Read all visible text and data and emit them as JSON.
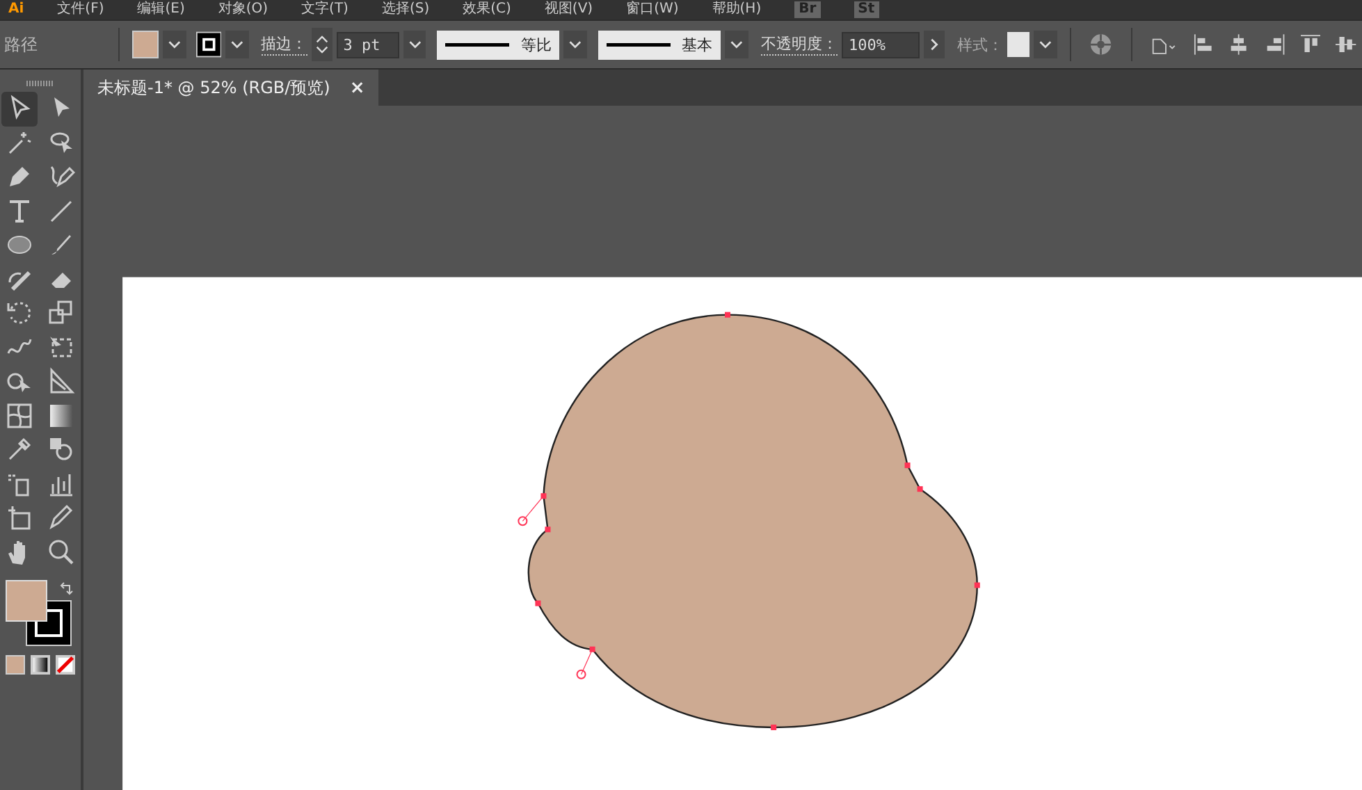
{
  "menu_bar": {
    "logo": "Ai",
    "items": [
      "文件(F)",
      "编辑(E)",
      "对象(O)",
      "文字(T)",
      "选择(S)",
      "效果(C)",
      "视图(V)",
      "窗口(W)",
      "帮助(H)"
    ],
    "apps": [
      "Br",
      "St"
    ]
  },
  "control_bar": {
    "object_type": "路径",
    "fill": {
      "color": "#cdaa92"
    },
    "stroke_label": "描边：",
    "stroke_weight": "3 pt",
    "profile": "等比",
    "brush": "基本",
    "opacity_label": "不透明度：",
    "opacity": "100%",
    "style_label": "样式："
  },
  "document_tab": {
    "title": "未标题-1* @ 52% (RGB/预览)",
    "close": "×"
  },
  "tools": [
    {
      "kind": "select",
      "selected": true
    },
    {
      "kind": "direct",
      "selected": false
    },
    {
      "kind": "wand",
      "selected": false
    },
    {
      "kind": "lasso",
      "selected": false
    },
    {
      "kind": "pen",
      "selected": false
    },
    {
      "kind": "curvature",
      "selected": false
    },
    {
      "kind": "type",
      "selected": false
    },
    {
      "kind": "line",
      "selected": false
    },
    {
      "kind": "ellipse",
      "selected": false
    },
    {
      "kind": "brush",
      "selected": false
    },
    {
      "kind": "shaper",
      "selected": false
    },
    {
      "kind": "eraser",
      "selected": false
    },
    {
      "kind": "rotate",
      "selected": false
    },
    {
      "kind": "scale",
      "selected": false
    },
    {
      "kind": "warp",
      "selected": false
    },
    {
      "kind": "transform",
      "selected": false
    },
    {
      "kind": "builder",
      "selected": false
    },
    {
      "kind": "perspective",
      "selected": false
    },
    {
      "kind": "mesh",
      "selected": false
    },
    {
      "kind": "gradient",
      "selected": false
    },
    {
      "kind": "eyedropper",
      "selected": false
    },
    {
      "kind": "blend",
      "selected": false
    },
    {
      "kind": "sprayer",
      "selected": false
    },
    {
      "kind": "graph",
      "selected": false
    },
    {
      "kind": "artboard",
      "selected": false
    },
    {
      "kind": "slice",
      "selected": false
    },
    {
      "kind": "hand",
      "selected": false
    },
    {
      "kind": "zoom",
      "selected": false
    }
  ]
}
